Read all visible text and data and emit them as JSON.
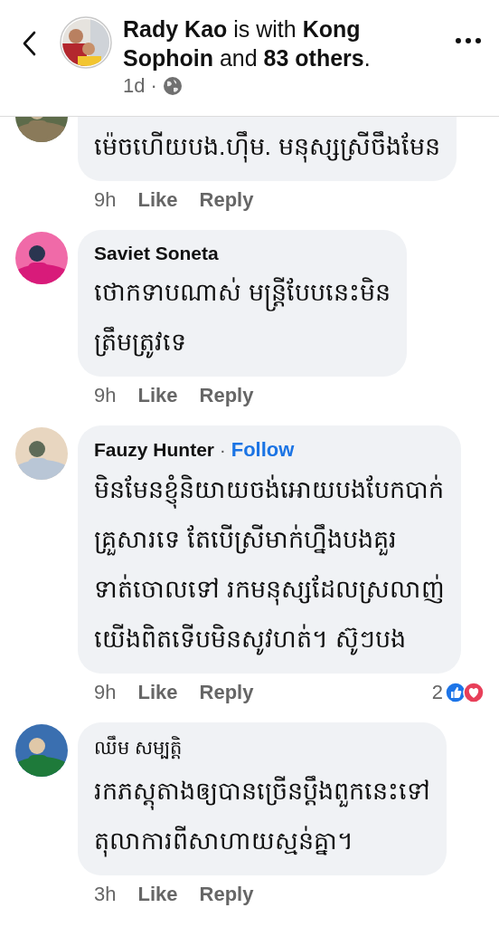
{
  "header": {
    "title": "**Rady Kao** is with **Kong Sophoin** and **83 others**.",
    "time": "1d ·"
  },
  "comments": [
    {
      "text": "ម៉េចហើយបង.ហ៊ឹម. មនុស្សស្រីចឹងមែន",
      "time": "9h",
      "like": "Like",
      "reply": "Reply"
    },
    {
      "name": "Saviet Soneta",
      "name_bold": true,
      "text": "ថោកទាបណាស់ មន្ត្រីបែបនេះមិន\nត្រឹមត្រូវទេ",
      "time": "9h",
      "like": "Like",
      "reply": "Reply"
    },
    {
      "name": "Fauzy Hunter",
      "name_bold": true,
      "separator": "·",
      "follow": "Follow",
      "text": "មិនមែនខ្ញុំនិយាយចង់អោយបងបែកបាក់\nគ្រួសារទេ តែបើស្រីមាក់ហ្នឹងបងគួរ\nទាត់ចោលទៅ រកមនុស្សដែលស្រលាញ់\nយើងពិតទើបមិនសូវហត់។ ស៊ូៗបង",
      "time": "9h",
      "like": "Like",
      "reply": "Reply",
      "reactions": "2"
    },
    {
      "name": "ឈឹម សម្បត្តិ",
      "name_bold": false,
      "text": "រកភស្តុតាងឲ្យបានច្រើនប្តឹងពួកនេះទៅ\nតុលាការពីសាហាយស្មន់គ្នា។",
      "time": "3h",
      "like": "Like",
      "reply": "Reply"
    }
  ]
}
